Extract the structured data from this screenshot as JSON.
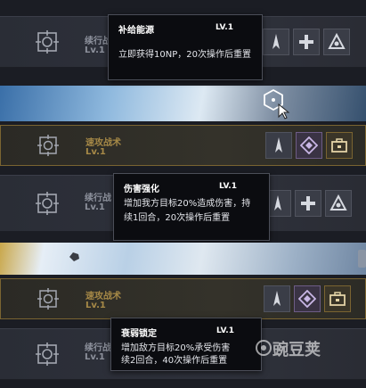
{
  "rows": [
    {
      "name": "续行战",
      "level": "Lv.1",
      "style": "gray"
    },
    {
      "name": "速攻战术",
      "level": "Lv.1",
      "style": "gold"
    },
    {
      "name": "续行战",
      "level": "Lv.1",
      "style": "gray"
    },
    {
      "name": "速攻战术",
      "level": "Lv.1",
      "style": "gold"
    },
    {
      "name": "续行战",
      "level": "Lv.1",
      "style": "gray"
    }
  ],
  "tooltips": [
    {
      "title": "补给能源",
      "level": "LV.1",
      "lines": [
        "立即获得10NP，20次操作后重置"
      ]
    },
    {
      "title": "伤害强化",
      "level": "LV.1",
      "lines": [
        "增加我方目标20%造成伤害，持",
        "续1回合，20次操作后重置"
      ]
    },
    {
      "title": "衰弱锁定",
      "level": "LV.1",
      "lines": [
        "增加敌方目标20%承受伤害",
        "续2回合，40次操作后重置"
      ]
    }
  ],
  "icons": {
    "row_emblem": "crosshair-emblem-icon",
    "skill_slots": [
      "blade-icon",
      "cross-plus-icon",
      "triangle-sigil-icon",
      "diamond-sigil-icon",
      "toolbox-icon"
    ]
  },
  "colors": {
    "gold_accent": "#a68947",
    "tooltip_bg": "#0b0c10",
    "row_bg": "#2f323c"
  },
  "watermark": "豌豆荚"
}
